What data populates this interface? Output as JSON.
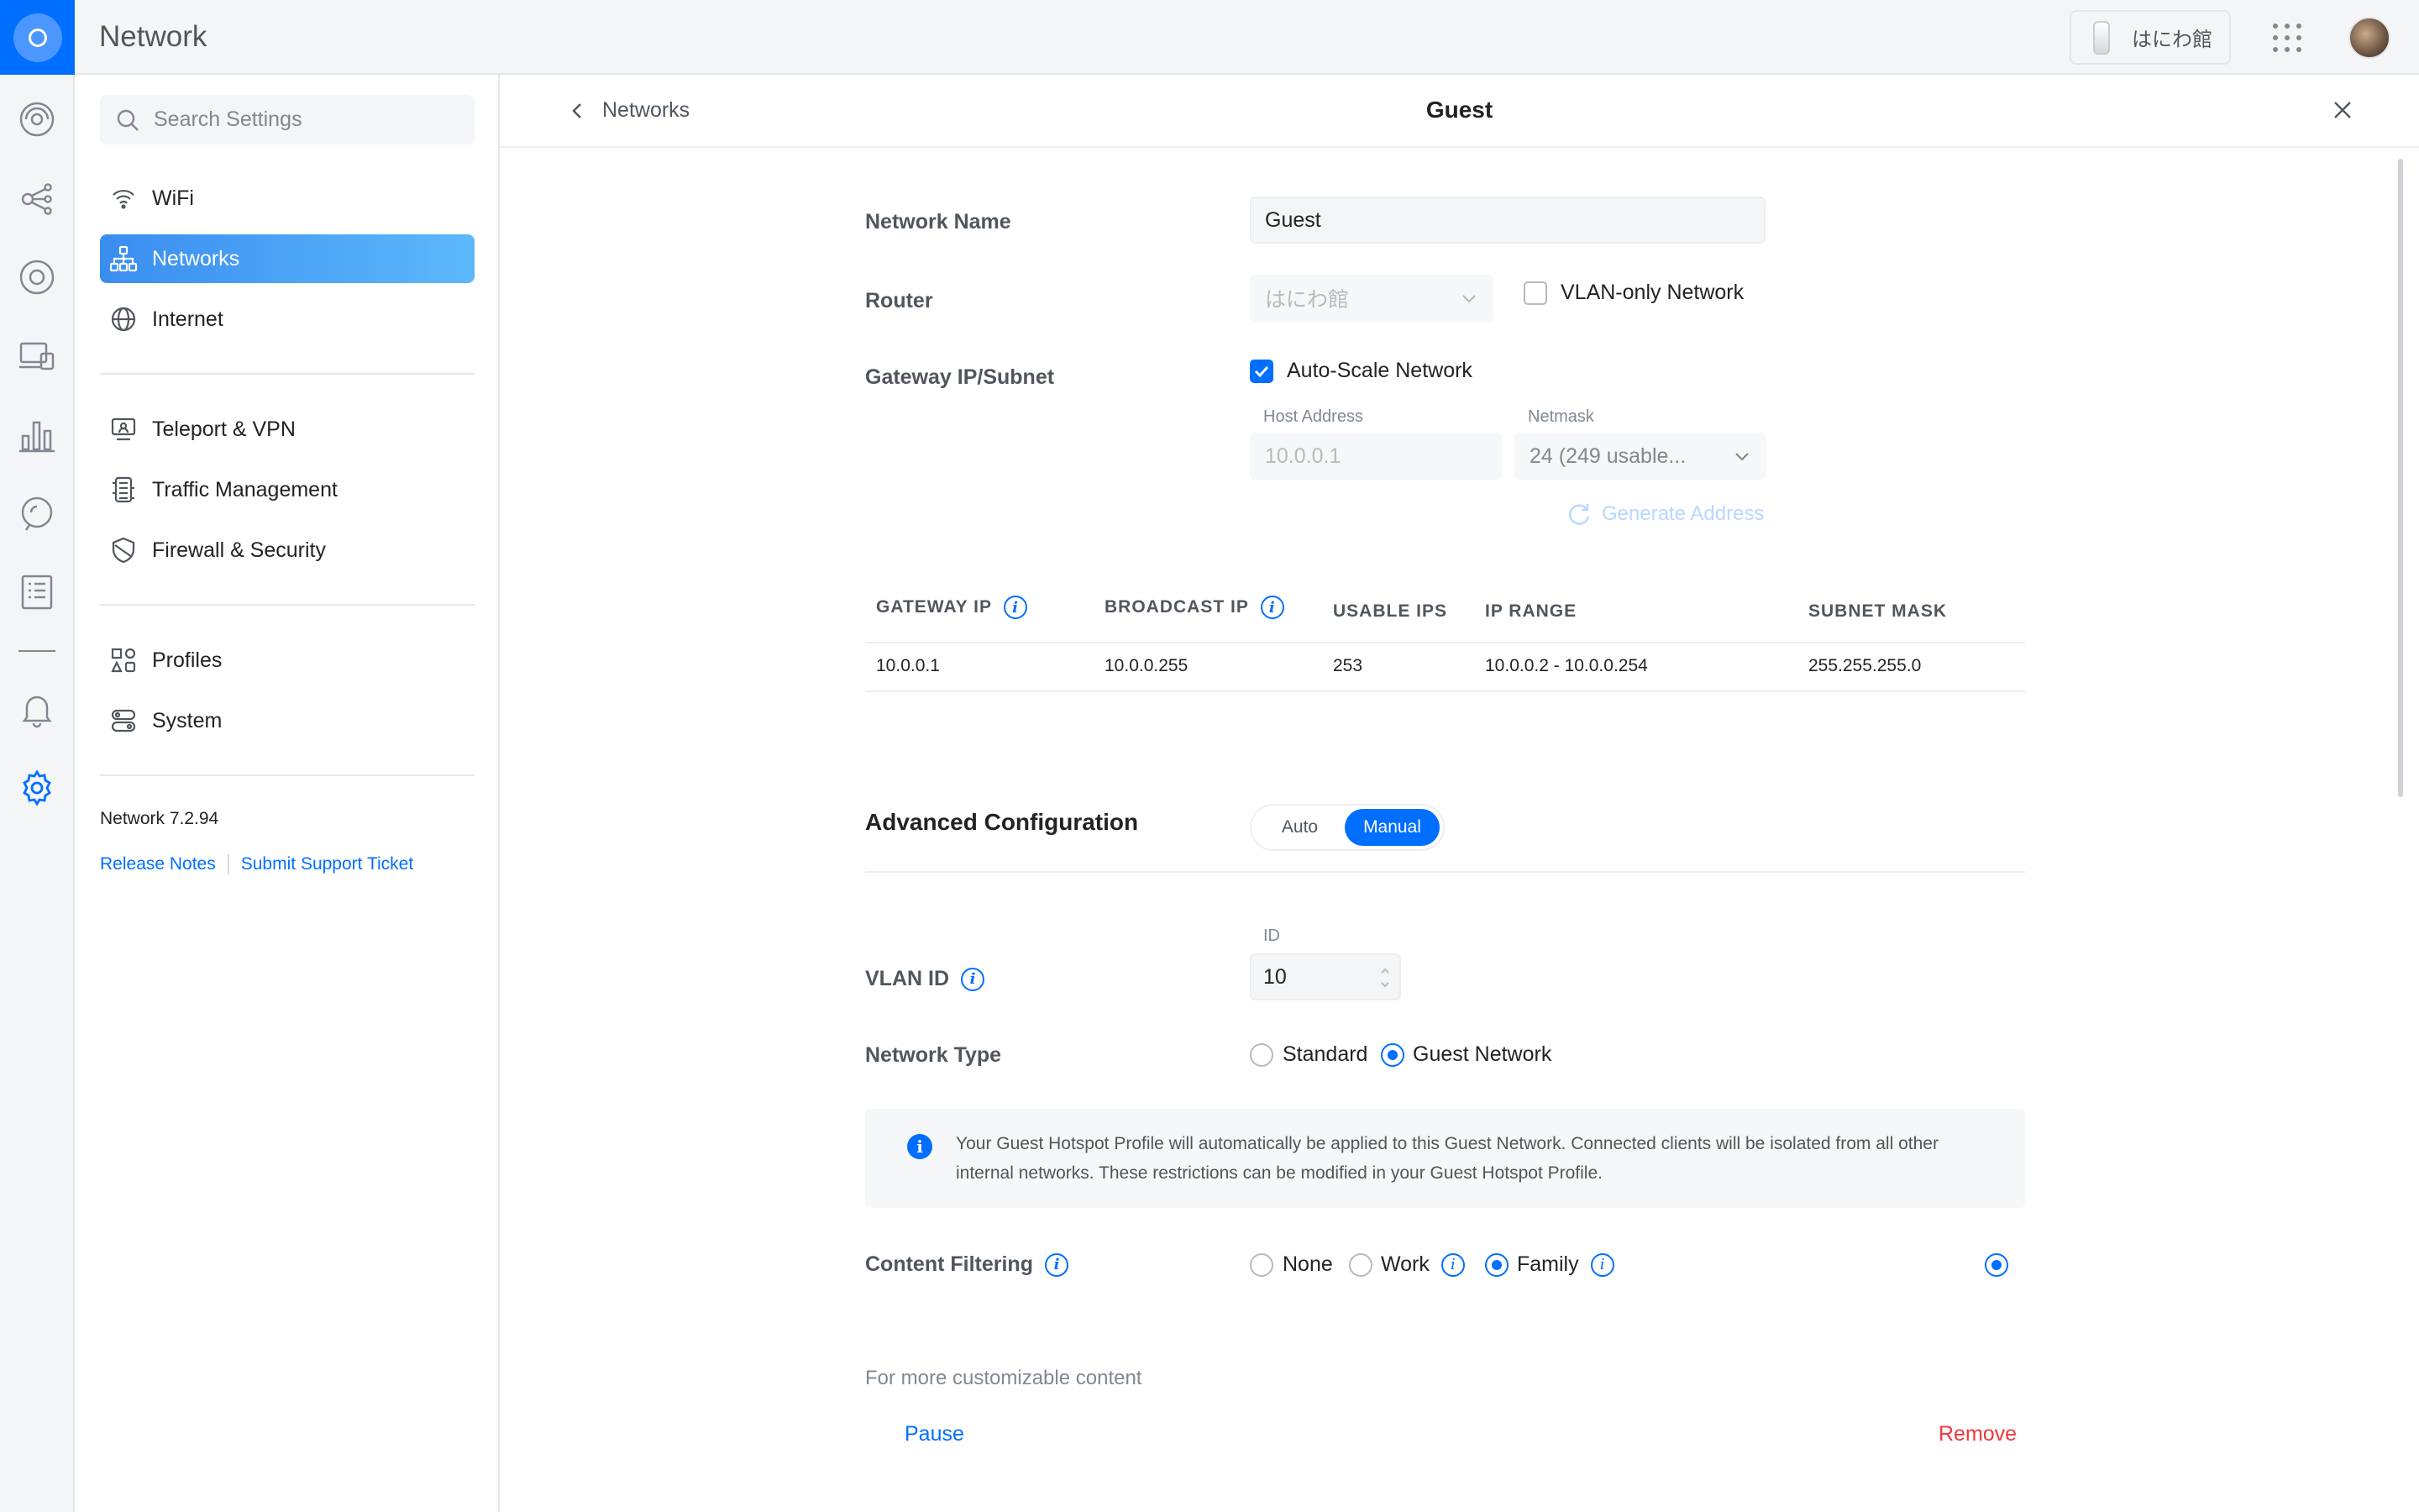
{
  "app": {
    "title": "Network"
  },
  "topbar": {
    "console_name": "はにわ館"
  },
  "sidebar": {
    "search_placeholder": "Search Settings",
    "groups": [
      [
        {
          "label": "WiFi"
        },
        {
          "label": "Networks"
        },
        {
          "label": "Internet"
        }
      ],
      [
        {
          "label": "Teleport & VPN"
        },
        {
          "label": "Traffic Management"
        },
        {
          "label": "Firewall & Security"
        }
      ],
      [
        {
          "label": "Profiles"
        },
        {
          "label": "System"
        }
      ]
    ],
    "active_item": "Networks",
    "version": "Network 7.2.94",
    "links": {
      "release_notes": "Release Notes",
      "support_ticket": "Submit Support Ticket"
    }
  },
  "panel": {
    "back_label": "Networks",
    "title": "Guest",
    "form": {
      "network_name_label": "Network Name",
      "network_name_value": "Guest",
      "router_label": "Router",
      "router_value": "はにわ館",
      "vlan_only_label": "VLAN-only Network",
      "vlan_only_checked": false,
      "gateway_label": "Gateway IP/Subnet",
      "auto_scale_label": "Auto-Scale Network",
      "auto_scale_checked": true,
      "host_address_label": "Host Address",
      "host_address_value": "10.0.0.1",
      "netmask_label": "Netmask",
      "netmask_value": "24 (249 usable...",
      "generate_address": "Generate Address"
    },
    "subnet_table": {
      "headers": [
        "GATEWAY IP",
        "BROADCAST IP",
        "USABLE IPS",
        "IP RANGE",
        "SUBNET MASK"
      ],
      "row": [
        "10.0.0.1",
        "10.0.0.255",
        "253",
        "10.0.0.2 - 10.0.0.254",
        "255.255.255.0"
      ]
    },
    "advanced": {
      "title": "Advanced Configuration",
      "options": [
        "Auto",
        "Manual"
      ],
      "selected": "Manual"
    },
    "vlan": {
      "label": "VLAN ID",
      "id_label": "ID",
      "value": "10"
    },
    "network_type": {
      "label": "Network Type",
      "options": [
        "Standard",
        "Guest Network"
      ],
      "selected": "Guest Network"
    },
    "notice": "Your Guest Hotspot Profile will automatically be applied to this Guest Network. Connected clients will be isolated from all other internal networks. These restrictions can be modified in your Guest Hotspot Profile.",
    "content_filtering": {
      "label": "Content Filtering",
      "options": [
        "None",
        "Work",
        "Family"
      ],
      "selected": "Family",
      "hint": "For more customizable content"
    },
    "actions": {
      "pause": "Pause",
      "remove": "Remove"
    }
  },
  "colors": {
    "accent": "#006fff",
    "danger": "#ee383b",
    "active_nav": "#4aa8f7"
  }
}
